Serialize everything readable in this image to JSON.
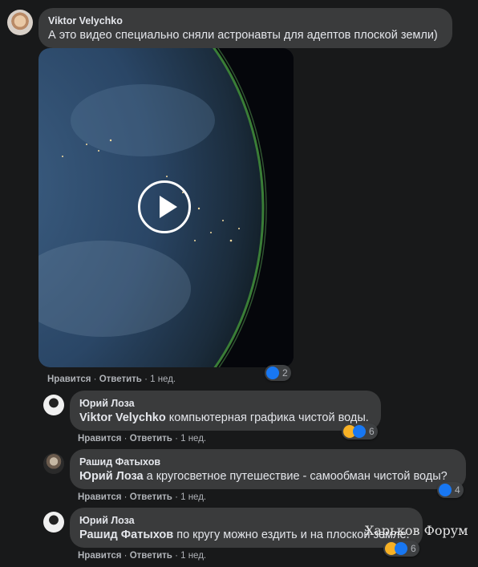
{
  "comments": [
    {
      "author": "Viktor Velychko",
      "mention": "",
      "text": "А это видео специально сняли астронавты для адептов плоской земли)",
      "like": "Нравится",
      "reply": "Ответить",
      "time": "1 нед.",
      "reaction_count": "2",
      "reactions": [
        "like-icon"
      ]
    },
    {
      "author": "Юрий Лоза",
      "mention": "Viktor Velychko",
      "text": " компьютерная графика чистой воды.",
      "like": "Нравится",
      "reply": "Ответить",
      "time": "1 нед.",
      "reaction_count": "6",
      "reactions": [
        "haha-icon",
        "like-icon"
      ]
    },
    {
      "author": "Рашид Фатыхов",
      "mention": "Юрий Лоза",
      "text": " а кругосветное путешествие - самообман чистой воды?",
      "like": "Нравится",
      "reply": "Ответить",
      "time": "1 нед.",
      "reaction_count": "4",
      "reactions": [
        "like-icon"
      ]
    },
    {
      "author": "Юрий Лоза",
      "mention": "Рашид Фатыхов",
      "text": " по кругу можно ездить и на плоской земле.",
      "like": "Нравится",
      "reply": "Ответить",
      "time": "1 нед.",
      "reaction_count": "6",
      "reactions": [
        "haha-icon",
        "like-icon"
      ]
    }
  ],
  "separator": "·",
  "watermark": "Харьков Форум",
  "colors": {
    "background": "#18191a",
    "bubble": "#3a3b3c",
    "like": "#1877f2",
    "haha": "#f7b125"
  }
}
